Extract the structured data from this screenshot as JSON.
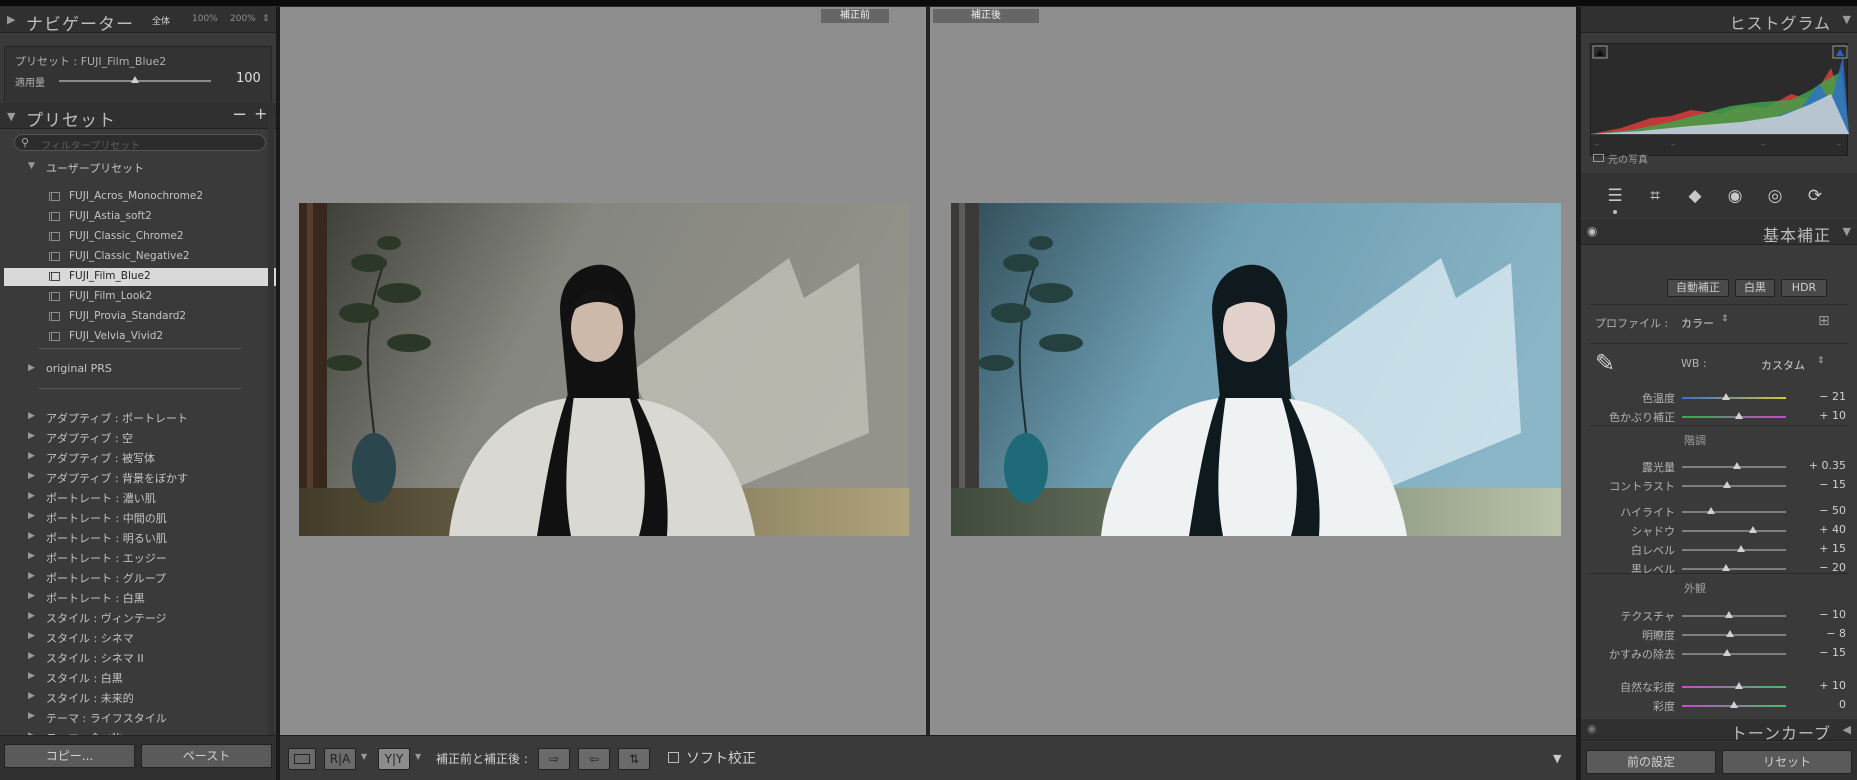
{
  "navigator": {
    "title": "ナビゲーター",
    "zoom_options": [
      "全体",
      "100%",
      "200%"
    ],
    "zoom_arrows": "⇕"
  },
  "preset_amount": {
    "preset_label": "プリセット : FUJI_Film_Blue2",
    "amount_label": "適用量",
    "amount_value": "100",
    "amount_fraction": 0.5
  },
  "presets": {
    "title": "プリセット",
    "minus": "−",
    "plus": "+.",
    "search_placeholder": "フィルタープリセット",
    "user_group": "ユーザープリセット",
    "user_items": [
      "FUJI_Acros_Monochrome2",
      "FUJI_Astia_soft2",
      "FUJI_Classic_Chrome2",
      "FUJI_Classic_Negative2",
      "FUJI_Film_Blue2",
      "FUJI_Film_Look2",
      "FUJI_Provia_Standard2",
      "FUJI_Velvia_Vivid2"
    ],
    "selected_index": 4,
    "original_group": "original PRS",
    "groups": [
      "アダプティブ : ポートレート",
      "アダプティブ : 空",
      "アダプティブ : 被写体",
      "アダプティブ : 背景をぼかす",
      "ポートレート : 濃い肌",
      "ポートレート : 中間の肌",
      "ポートレート : 明るい肌",
      "ポートレート : エッジー",
      "ポートレート : グループ",
      "ポートレート : 白黒",
      "スタイル : ヴィンテージ",
      "スタイル : シネマ",
      "スタイル : シネマ II",
      "スタイル : 白黒",
      "スタイル : 未来的",
      "テーマ : ライフスタイル",
      "テーマ : 食べ物"
    ]
  },
  "left_buttons": {
    "copy": "コピー...",
    "paste": "ペースト"
  },
  "views": {
    "before": "補正前",
    "after": "補正後"
  },
  "toolbar": {
    "ra": "R|A",
    "yy": "Y|Y",
    "compare_label": "補正前と補正後 :",
    "soft_proof": "ソフト校正"
  },
  "histogram": {
    "title": "ヒストグラム",
    "original_photo": "元の写真",
    "colors": {
      "red": "#d23b3b",
      "green": "#3fa24a",
      "blue": "#2f72c9",
      "luma": "#d8d8d8"
    }
  },
  "basic": {
    "title": "基本補正",
    "auto": "自動補正",
    "bw": "白黒",
    "hdr": "HDR",
    "profile_label": "プロファイル :",
    "profile_value": "カラー",
    "wb_label": "WB :",
    "wb_value": "カスタム",
    "wb_sliders": [
      {
        "label": "色温度",
        "value": "− 21",
        "pos": 0.42
      },
      {
        "label": "色かぶり補正",
        "value": "+ 10",
        "pos": 0.55
      }
    ],
    "tone_title": "階調",
    "tone_sliders": [
      {
        "label": "露光量",
        "value": "+ 0.35",
        "pos": 0.53
      },
      {
        "label": "コントラスト",
        "value": "− 15",
        "pos": 0.43
      }
    ],
    "tone_sliders2": [
      {
        "label": "ハイライト",
        "value": "− 50",
        "pos": 0.28
      },
      {
        "label": "シャドウ",
        "value": "+ 40",
        "pos": 0.68
      },
      {
        "label": "白レベル",
        "value": "+ 15",
        "pos": 0.57
      },
      {
        "label": "黒レベル",
        "value": "− 20",
        "pos": 0.42
      }
    ],
    "presence_title": "外観",
    "presence_sliders": [
      {
        "label": "テクスチャ",
        "value": "− 10",
        "pos": 0.45
      },
      {
        "label": "明瞭度",
        "value": "− 8",
        "pos": 0.46
      },
      {
        "label": "かすみの除去",
        "value": "− 15",
        "pos": 0.43
      }
    ],
    "color_sliders": [
      {
        "label": "自然な彩度",
        "value": "+ 10",
        "pos": 0.55
      },
      {
        "label": "彩度",
        "value": "0",
        "pos": 0.5
      }
    ]
  },
  "tone_curve": {
    "title": "トーンカーブ"
  },
  "right_buttons": {
    "previous": "前の設定",
    "reset": "リセット"
  }
}
